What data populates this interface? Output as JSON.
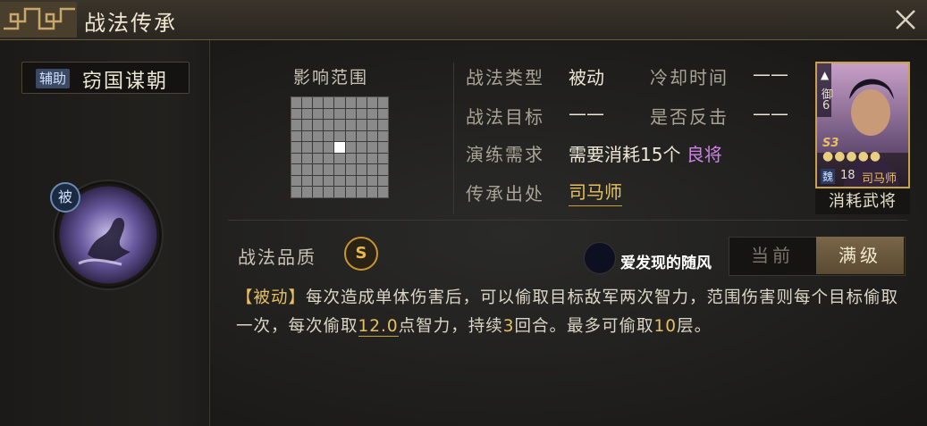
{
  "window": {
    "title": "战法传承"
  },
  "skill": {
    "category_tag": "辅助",
    "name": "窃国谋朝",
    "passive_badge": "被"
  },
  "range": {
    "label": "影响范围",
    "grid_size": 9,
    "center_highlighted": true
  },
  "info": {
    "type_label": "战法类型",
    "type_value": "被动",
    "cooldown_label": "冷却时间",
    "cooldown_value": "——",
    "target_label": "战法目标",
    "target_value": "——",
    "counter_label": "是否反击",
    "counter_value": "——",
    "training_label": "演练需求",
    "training_prefix": "需要消耗",
    "training_count": "15个",
    "training_quality": "良将",
    "origin_label": "传承出处",
    "origin_value": "司马师"
  },
  "hero_card": {
    "side_label": "御",
    "side_num": "6",
    "rank": "S3",
    "faction": "魏",
    "cost": "18",
    "name": "司马师",
    "caption": "消耗武将"
  },
  "quality": {
    "label": "战法品质",
    "value": "S"
  },
  "watermark": {
    "text": "爱发现的随风"
  },
  "toggle": {
    "current_label": "当前",
    "max_label": "满级",
    "selected": "满级"
  },
  "description": {
    "tag": "【被动】",
    "part1": "每次造成单体伤害后，可以偷取目标敌军两次智力，范围伤害则每个目标偷取一次，每次偷取",
    "amount": "12.0",
    "part2": "点智力，持续",
    "turns": "3",
    "part3": "回合。最多可偷取",
    "stacks": "10",
    "part4": "层。"
  },
  "colors": {
    "gold": "#e8c060",
    "purple": "#d080e8",
    "tag_blue": "#3b4a62"
  }
}
